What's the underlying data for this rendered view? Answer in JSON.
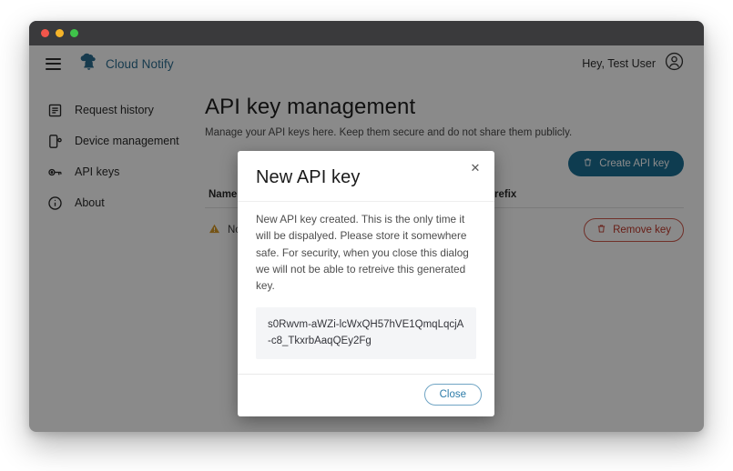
{
  "window": {
    "traffic_lights": [
      "close",
      "minimize",
      "maximize"
    ],
    "colors": {
      "titlebar": "#3a3a3c",
      "red": "#f2564b",
      "yellow": "#f5b429",
      "green": "#3fc34a",
      "brand": "#2c6e91",
      "primary_button": "#1b6f94",
      "danger": "#c0392b",
      "dim_overlay": "rgba(0,0,0,0.46)"
    }
  },
  "topbar": {
    "menu_icon": "hamburger-icon",
    "brand_icon": "cloud-bell-icon",
    "brand_name": "Cloud Notify",
    "greeting": "Hey, Test User",
    "avatar_icon": "user-avatar-icon"
  },
  "sidebar": {
    "items": [
      {
        "label": "Request history",
        "icon": "list-document-icon"
      },
      {
        "label": "Device management",
        "icon": "mobile-device-icon"
      },
      {
        "label": "API keys",
        "icon": "key-icon"
      },
      {
        "label": "About",
        "icon": "info-circle-icon"
      }
    ]
  },
  "main": {
    "title": "API key management",
    "subtitle": "Manage your API keys here. Keep them secure and do not share them publicly.",
    "create_button": {
      "label": "Create API key",
      "icon": "trash-icon"
    },
    "table": {
      "headers": [
        "Name",
        "Prefix"
      ],
      "rows": [
        {
          "warning_icon": "warning-triangle-icon",
          "text": "No keys available",
          "remove_button": {
            "label": "Remove key",
            "icon": "trash-icon"
          }
        }
      ]
    }
  },
  "modal": {
    "title": "New API key",
    "close_icon": "close-x-icon",
    "body_text": "New API key created. This is the only time it will be dispalyed. Please store it somewhere safe. For security, when you close this dialog we will not be able to retreive this generated key.",
    "api_key": "s0Rwvm-aWZi-lcWxQH57hVE1QmqLqcjA-c8_TkxrbAaqQEy2Fg",
    "close_button_label": "Close"
  }
}
